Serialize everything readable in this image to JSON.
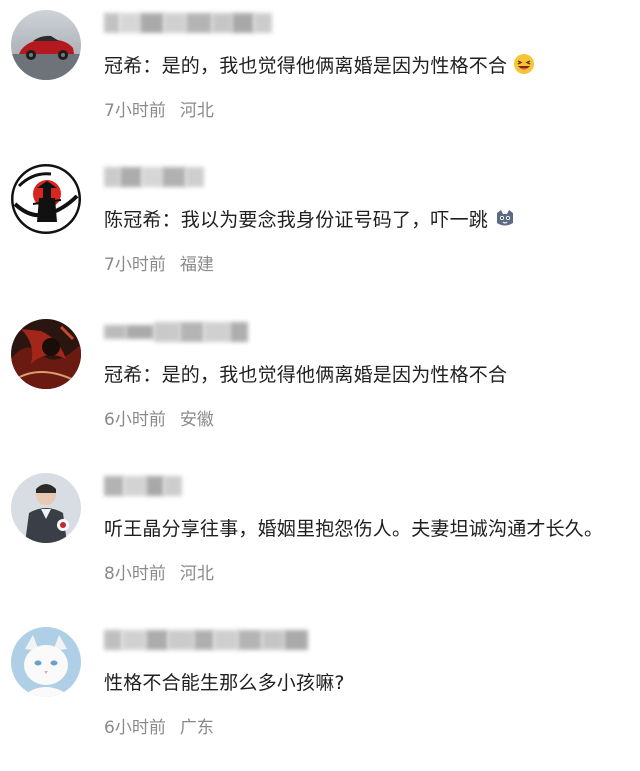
{
  "comments": [
    {
      "text": "冠希：是的，我也觉得他俩离婚是因为性格不合",
      "emoji": "grinning-squint-face",
      "time": "7小时前",
      "location": "河北",
      "avatar": "red-sports-car"
    },
    {
      "text": "陈冠希：我以为要念我身份证号码了，吓一跳",
      "emoji": "cat-face",
      "time": "7小时前",
      "location": "福建",
      "avatar": "samurai-red-sun"
    },
    {
      "text": "冠希：是的，我也觉得他俩离婚是因为性格不合",
      "emoji": "",
      "time": "6小时前",
      "location": "安徽",
      "avatar": "dark-artwork"
    },
    {
      "text": "听王晶分享往事，婚姻里抱怨伤人。夫妻坦诚沟通才长久。",
      "emoji": "",
      "time": "8小时前",
      "location": "河北",
      "avatar": "person-in-uniform"
    },
    {
      "text": "性格不合能生那么多小孩嘛?",
      "emoji": "",
      "time": "6小时前",
      "location": "广东",
      "avatar": "white-cat"
    }
  ],
  "colors": {
    "text": "#1f1f1f",
    "meta": "#8a8a8a",
    "background": "#ffffff"
  }
}
